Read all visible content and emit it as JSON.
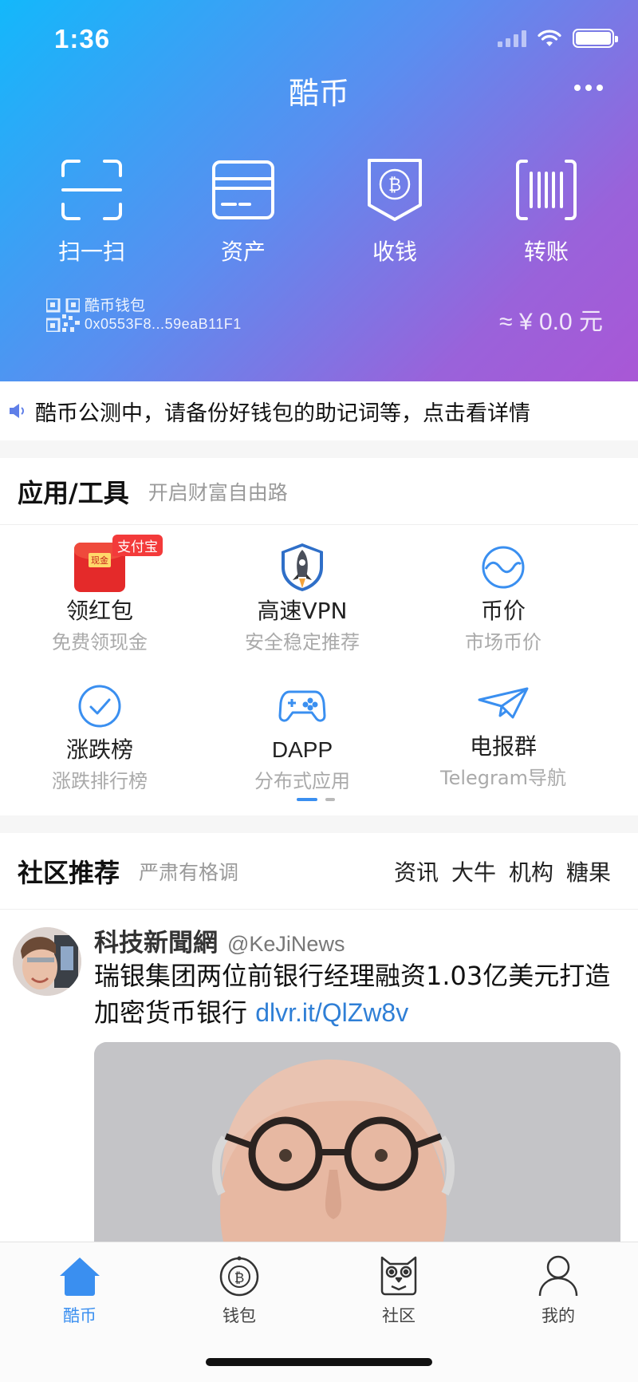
{
  "status_bar": {
    "time": "1:36"
  },
  "header": {
    "title": "酷币"
  },
  "actions": [
    {
      "label": "扫一扫",
      "icon": "scan-icon"
    },
    {
      "label": "资产",
      "icon": "card-icon"
    },
    {
      "label": "收钱",
      "icon": "bitcoin-receive-icon"
    },
    {
      "label": "转账",
      "icon": "transfer-barcode-icon"
    }
  ],
  "wallet": {
    "name": "酷币钱包",
    "address": "0x0553F8...59eaB11F1",
    "balance": "≈ ¥ 0.0 元"
  },
  "notice": {
    "text": "酷币公测中，请备份好钱包的助记词等，点击看详情"
  },
  "tools_section": {
    "title": "应用/工具",
    "subtitle": "开启财富自由路"
  },
  "tools": [
    {
      "name": "领红包",
      "desc": "免费领现金",
      "icon": "red-packet-icon",
      "badge": "支付宝",
      "badge_inner": "现金"
    },
    {
      "name": "高速VPN",
      "desc": "安全稳定推荐",
      "icon": "rocket-shield-icon"
    },
    {
      "name": "币价",
      "desc": "市场币价",
      "icon": "wave-circle-icon"
    },
    {
      "name": "涨跌榜",
      "desc": "涨跌排行榜",
      "icon": "check-circle-icon"
    },
    {
      "name": "DAPP",
      "desc": "分布式应用",
      "icon": "gamepad-icon"
    },
    {
      "name": "电报群",
      "desc": "Telegram导航",
      "icon": "paper-plane-icon"
    }
  ],
  "community_section": {
    "title": "社区推荐",
    "subtitle": "严肃有格调",
    "links": [
      "资讯",
      "大牛",
      "机构",
      "糖果"
    ]
  },
  "post": {
    "author": "科技新聞網",
    "handle": "@KeJiNews",
    "text": "瑞银集团两位前银行经理融资1.03亿美元打造加密货币银行",
    "link": "dlvr.it/QlZw8v"
  },
  "tabbar": [
    {
      "label": "酷币",
      "icon": "home-icon",
      "active": true
    },
    {
      "label": "钱包",
      "icon": "bitcoin-wallet-icon",
      "active": false
    },
    {
      "label": "社区",
      "icon": "owl-icon",
      "active": false
    },
    {
      "label": "我的",
      "icon": "user-icon",
      "active": false
    }
  ],
  "colors": {
    "accent": "#3a8ff0",
    "gradient_start": "#13b8fb",
    "gradient_end": "#a957d6",
    "link": "#2f7fd6"
  }
}
